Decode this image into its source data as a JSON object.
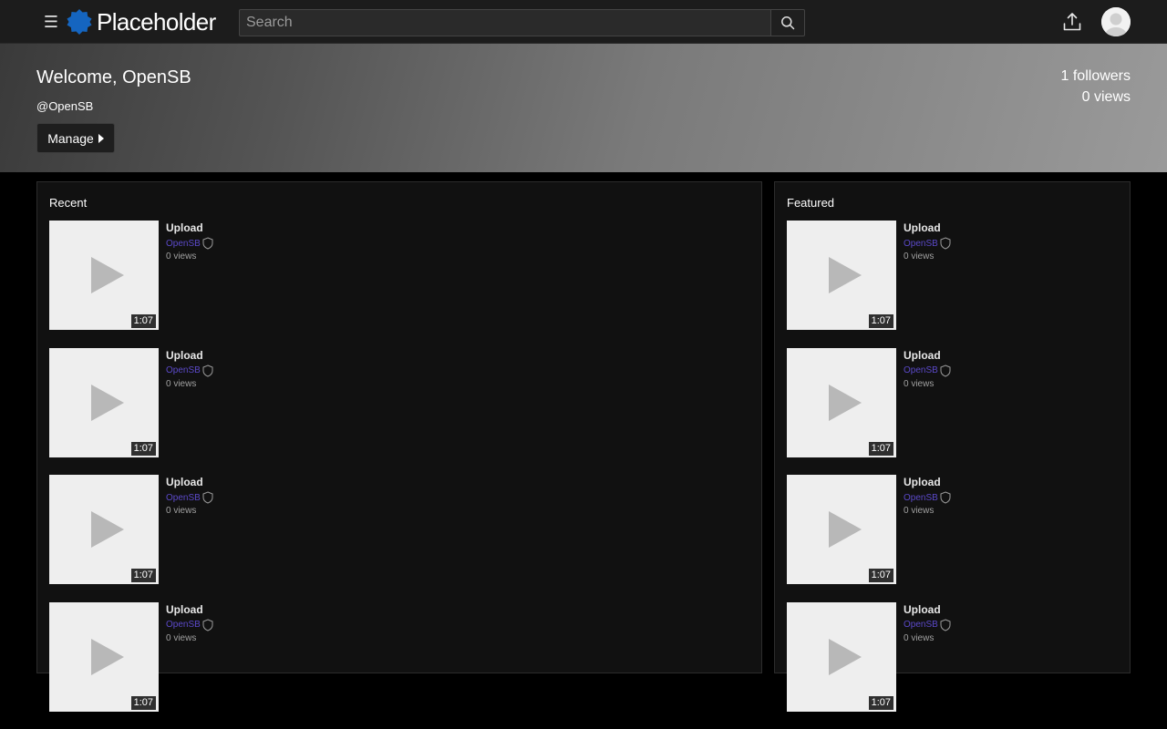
{
  "header": {
    "menu_icon": "hamburger-icon",
    "logo_text": "Placeholder",
    "search_placeholder": "Search",
    "search_icon": "search-icon",
    "upload_icon": "upload-icon",
    "avatar_icon": "user-avatar-icon"
  },
  "banner": {
    "welcome": "Welcome, OpenSB",
    "handle": "@OpenSB",
    "manage_label": "Manage",
    "followers": "1 followers",
    "views": "0 views"
  },
  "recent": {
    "title": "Recent",
    "videos": [
      {
        "title": "Upload",
        "author": "OpenSB",
        "views": "0 views",
        "duration": "1:07"
      },
      {
        "title": "Upload",
        "author": "OpenSB",
        "views": "0 views",
        "duration": "1:07"
      },
      {
        "title": "Upload",
        "author": "OpenSB",
        "views": "0 views",
        "duration": "1:07"
      },
      {
        "title": "Upload",
        "author": "OpenSB",
        "views": "0 views",
        "duration": "1:07"
      }
    ]
  },
  "featured": {
    "title": "Featured",
    "videos": [
      {
        "title": "Upload",
        "author": "OpenSB",
        "views": "0 views",
        "duration": "1:07"
      },
      {
        "title": "Upload",
        "author": "OpenSB",
        "views": "0 views",
        "duration": "1:07"
      },
      {
        "title": "Upload",
        "author": "OpenSB",
        "views": "0 views",
        "duration": "1:07"
      },
      {
        "title": "Upload",
        "author": "OpenSB",
        "views": "0 views",
        "duration": "1:07"
      }
    ]
  },
  "colors": {
    "topbar": "#1c1c1c",
    "page_bg": "#000000",
    "panel_bg": "#111111",
    "author_link": "#5b49c9",
    "logo_blue": "#1565c0"
  }
}
